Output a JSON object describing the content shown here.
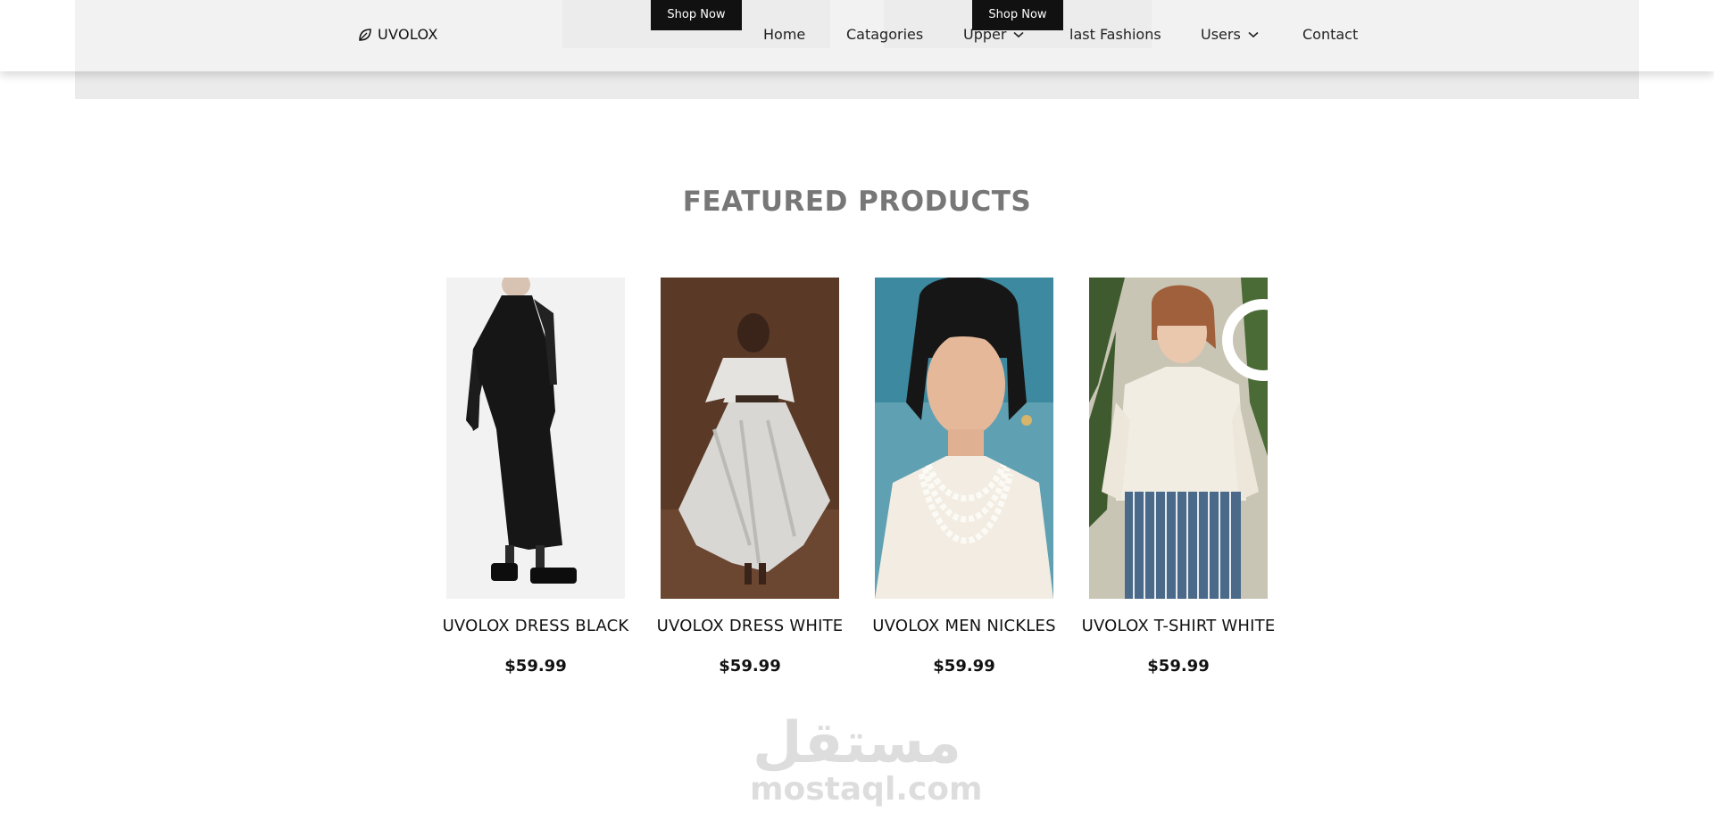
{
  "header": {
    "logo_text": "UVOLOX",
    "logo_icon": "leaf-outline-icon",
    "nav": {
      "home": "Home",
      "categories": "Catagories",
      "upper": "Upper",
      "last_fashions": "last Fashions",
      "users": "Users",
      "contact": "Contact"
    }
  },
  "hero": {
    "shop_now_1": "Shop Now",
    "shop_now_2": "Shop Now"
  },
  "featured": {
    "title": "FEATURED PRODUCTS",
    "products": [
      {
        "name": "UVOLOX DRESS BLACK",
        "price": "$59.99",
        "image": "model-black-dress"
      },
      {
        "name": "UVOLOX DRESS WHITE",
        "price": "$59.99",
        "image": "model-white-dress"
      },
      {
        "name": "UVOLOX MEN NICKLES",
        "price": "$59.99",
        "image": "model-pearl-necklaces"
      },
      {
        "name": "UVOLOX T-SHIRT WHITE",
        "price": "$59.99",
        "image": "model-white-shirt-striped-pants"
      }
    ]
  },
  "watermark": {
    "arabic": "مستقل",
    "latin": "mostaql.com"
  },
  "colors": {
    "accent_dark": "#111111",
    "title_gray": "#777777",
    "band_gray": "#ebebeb"
  }
}
